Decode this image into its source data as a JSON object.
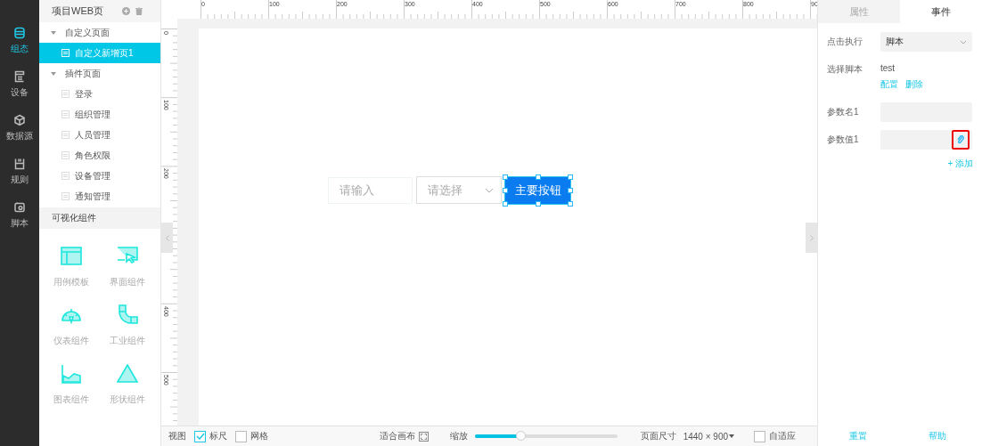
{
  "nav": [
    {
      "label": "组态",
      "selected": true
    },
    {
      "label": "设备",
      "selected": false
    },
    {
      "label": "数据源",
      "selected": false
    },
    {
      "label": "规则",
      "selected": false
    },
    {
      "label": "脚本",
      "selected": false
    }
  ],
  "sidebar": {
    "title": "项目WEB页",
    "tree": [
      {
        "label": "自定义页面",
        "expanded": true,
        "children": [
          {
            "label": "自定义新增页1",
            "selected": true
          }
        ]
      },
      {
        "label": "插件页面",
        "expanded": true,
        "children": [
          {
            "label": "登录",
            "selected": false
          },
          {
            "label": "组织管理",
            "selected": false
          },
          {
            "label": "人员管理",
            "selected": false
          },
          {
            "label": "角色权限",
            "selected": false
          },
          {
            "label": "设备管理",
            "selected": false
          },
          {
            "label": "通知管理",
            "selected": false
          }
        ]
      }
    ],
    "components_title": "可视化组件",
    "components": [
      {
        "label": "用例模板",
        "kind": "template"
      },
      {
        "label": "界面组件",
        "kind": "ui"
      },
      {
        "label": "仪表组件",
        "kind": "gauge"
      },
      {
        "label": "工业组件",
        "kind": "pipe"
      },
      {
        "label": "图表组件",
        "kind": "chart"
      },
      {
        "label": "形状组件",
        "kind": "shape"
      }
    ]
  },
  "ruler": {
    "x_labels": [
      "0",
      "100",
      "200",
      "300",
      "400",
      "500",
      "600",
      "700",
      "800",
      "90"
    ],
    "y_labels": [
      "0",
      "100",
      "200",
      "400",
      "500"
    ]
  },
  "canvas": {
    "widgets": [
      {
        "kind": "input",
        "placeholder": "请输入"
      },
      {
        "kind": "select",
        "placeholder": "请选择"
      },
      {
        "kind": "button",
        "label": "主要按钮",
        "selected": true
      }
    ]
  },
  "bottom_bar": {
    "view_label": "视图",
    "ruler": {
      "label": "标尺",
      "checked": true
    },
    "grid": {
      "label": "网格",
      "checked": false
    },
    "fit_label": "适合画布",
    "zoom_label": "缩放",
    "zoom": {
      "level": 0.33
    },
    "size_label": "页面尺寸",
    "size_value": "1440 × 900",
    "auto": {
      "label": "自适应",
      "checked": false
    }
  },
  "panel": {
    "tabs": [
      {
        "label": "属性",
        "selected": false
      },
      {
        "label": "事件",
        "selected": true
      }
    ],
    "action_label": "点击执行",
    "action_value": "脚本",
    "script_label": "选择脚本",
    "script_value": "test",
    "links": [
      "配置",
      "删除"
    ],
    "params": [
      {
        "label": "参数名1",
        "kind": "text"
      },
      {
        "label": "参数值1",
        "kind": "link",
        "highlighted": true
      }
    ],
    "add_label": "+ 添加",
    "buttons": [
      "重置",
      "帮助"
    ]
  }
}
